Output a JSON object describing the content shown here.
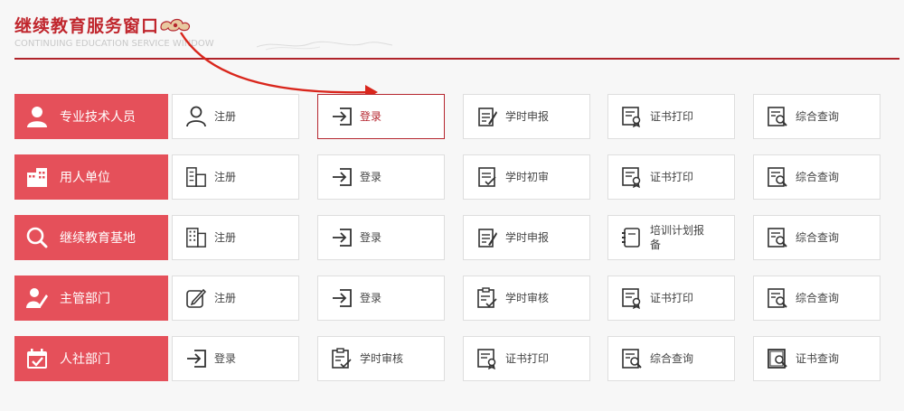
{
  "header": {
    "title": "继续教育服务窗口",
    "subtitle": "CONTINUING EDUCATION SERVICE WINDOW"
  },
  "colors": {
    "brand": "#c0262d",
    "category_bg": "#e5505a",
    "active_border": "#b5262f"
  },
  "rows": [
    {
      "category": {
        "label": "专业技术人员",
        "icon": "person-icon"
      },
      "buttons": [
        {
          "label": "注册",
          "icon": "user-outline-icon"
        },
        {
          "label": "登录",
          "icon": "login-arrow-icon",
          "active": true
        },
        {
          "label": "学时申报",
          "icon": "edit-document-icon"
        },
        {
          "label": "证书打印",
          "icon": "certificate-icon"
        },
        {
          "label": "综合查询",
          "icon": "search-document-icon"
        }
      ]
    },
    {
      "category": {
        "label": "用人单位",
        "icon": "building-icon"
      },
      "buttons": [
        {
          "label": "注册",
          "icon": "building-outline-icon"
        },
        {
          "label": "登录",
          "icon": "login-arrow-icon"
        },
        {
          "label": "学时初审",
          "icon": "checklist-icon"
        },
        {
          "label": "证书打印",
          "icon": "certificate-icon"
        },
        {
          "label": "综合查询",
          "icon": "search-document-icon"
        }
      ]
    },
    {
      "category": {
        "label": "继续教育基地",
        "icon": "search-icon"
      },
      "buttons": [
        {
          "label": "注册",
          "icon": "tall-building-icon"
        },
        {
          "label": "登录",
          "icon": "login-arrow-icon"
        },
        {
          "label": "学时申报",
          "icon": "edit-document-icon"
        },
        {
          "label": "培训计划报备",
          "icon": "planner-icon"
        },
        {
          "label": "综合查询",
          "icon": "search-document-icon"
        }
      ]
    },
    {
      "category": {
        "label": "主管部门",
        "icon": "manager-icon"
      },
      "buttons": [
        {
          "label": "注册",
          "icon": "pencil-box-icon"
        },
        {
          "label": "登录",
          "icon": "login-arrow-icon"
        },
        {
          "label": "学时审核",
          "icon": "review-document-icon"
        },
        {
          "label": "证书打印",
          "icon": "certificate-icon"
        },
        {
          "label": "综合查询",
          "icon": "search-document-icon"
        }
      ]
    },
    {
      "category": {
        "label": "人社部门",
        "icon": "calendar-check-icon"
      },
      "buttons": [
        {
          "label": "登录",
          "icon": "login-arrow-icon"
        },
        {
          "label": "学时审核",
          "icon": "review-document-icon"
        },
        {
          "label": "证书打印",
          "icon": "certificate-icon"
        },
        {
          "label": "综合查询",
          "icon": "search-document-icon"
        },
        {
          "label": "证书查询",
          "icon": "certificate-search-icon"
        }
      ]
    }
  ]
}
